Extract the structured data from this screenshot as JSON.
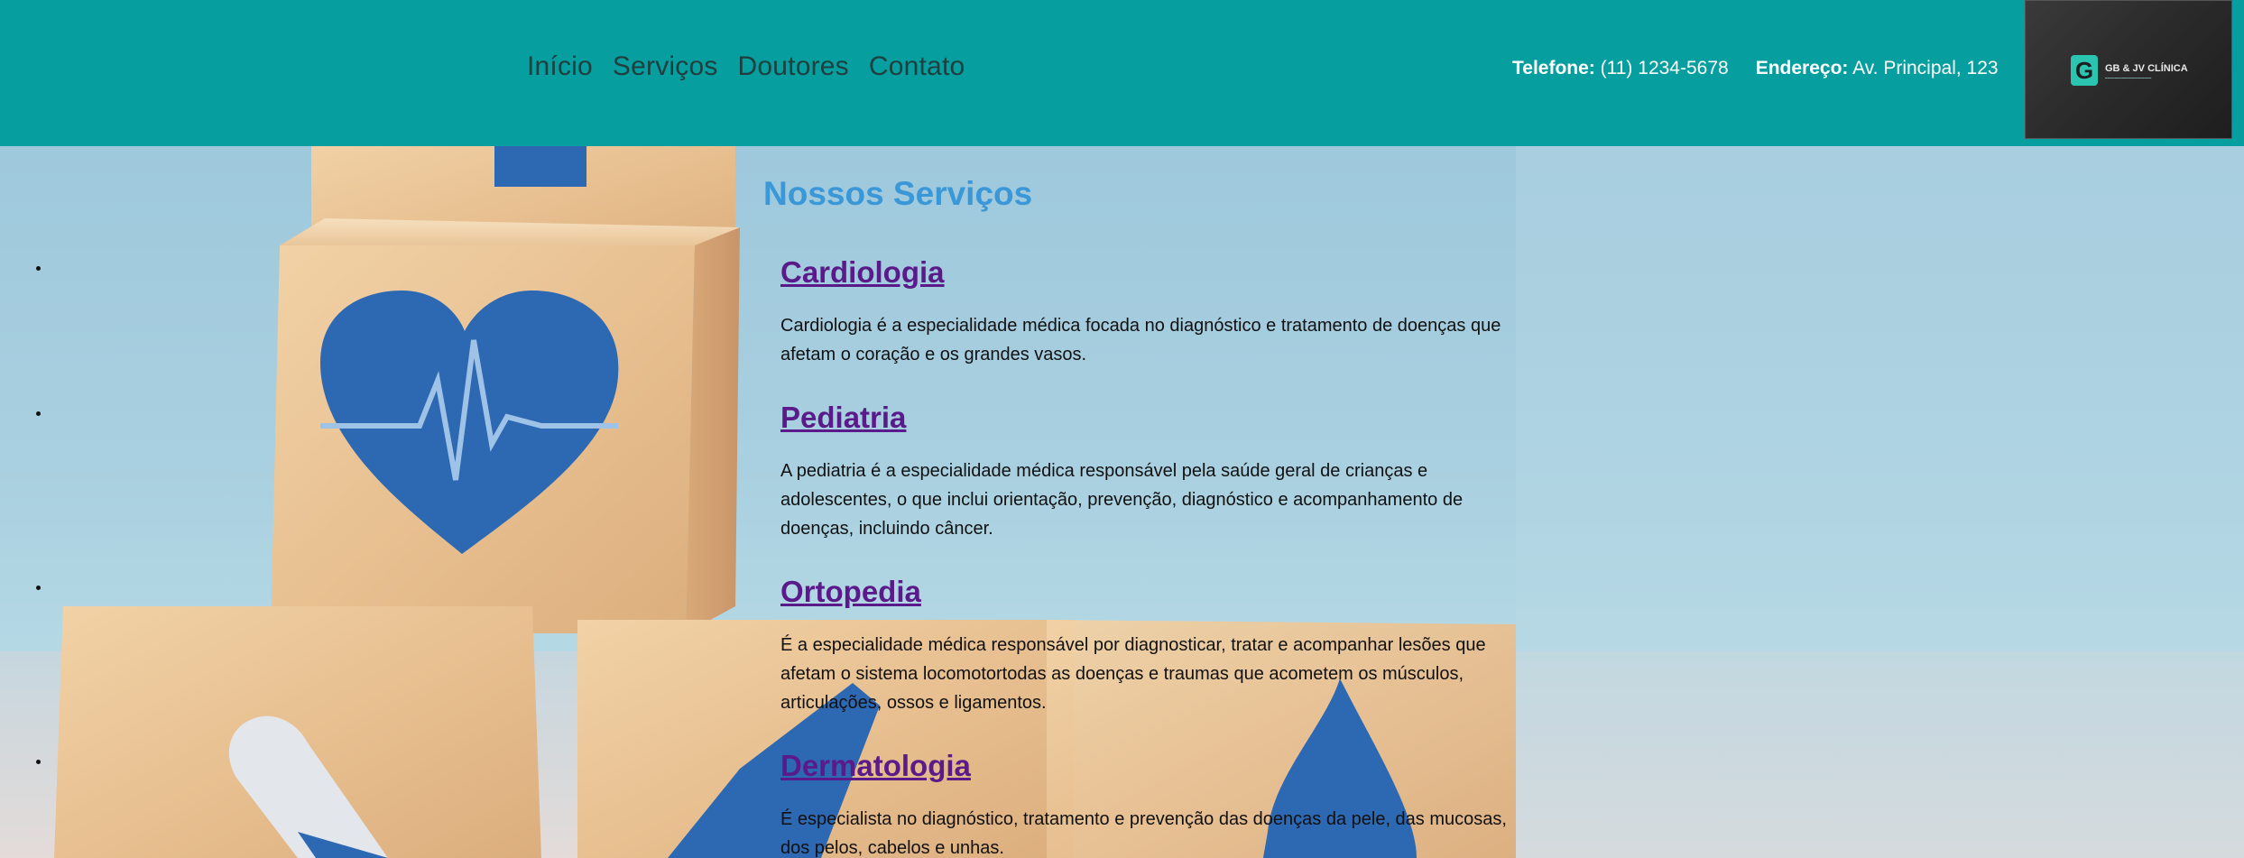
{
  "nav": {
    "items": [
      "Início",
      "Serviços",
      "Doutores",
      "Contato"
    ]
  },
  "contact": {
    "phone_label": "Telefone:",
    "phone_value": "(11) 1234-5678",
    "address_label": "Endereço:",
    "address_value": "Av. Principal, 123"
  },
  "logo": {
    "mark": "G",
    "title": "GB & JV CLÍNICA"
  },
  "services": {
    "title": "Nossos Serviços",
    "items": [
      {
        "name": "Cardiologia",
        "description": "Cardiologia é a especialidade médica focada no diagnóstico e tratamento de doenças que afetam o coração e os grandes vasos."
      },
      {
        "name": "Pediatria",
        "description": "A pediatria é a especialidade médica responsável pela saúde geral de crianças e adolescentes, o que inclui orientação, prevenção, diagnóstico e acompanhamento de doenças, incluindo câncer."
      },
      {
        "name": "Ortopedia",
        "description": "É a especialidade médica responsável por diagnosticar, tratar e acompanhar lesões que afetam o sistema locomotortodas as doenças e traumas que acometem os músculos, articulações, ossos e ligamentos."
      },
      {
        "name": "Dermatologia",
        "description": "É especialista no diagnóstico, tratamento e prevenção das doenças da pele, das mucosas, dos pelos, cabelos e unhas."
      }
    ]
  },
  "colors": {
    "header_bg": "#069e9f",
    "nav_text": "#1f3f3f",
    "section_title": "#3a97d8",
    "service_link": "#5a1a8a"
  }
}
